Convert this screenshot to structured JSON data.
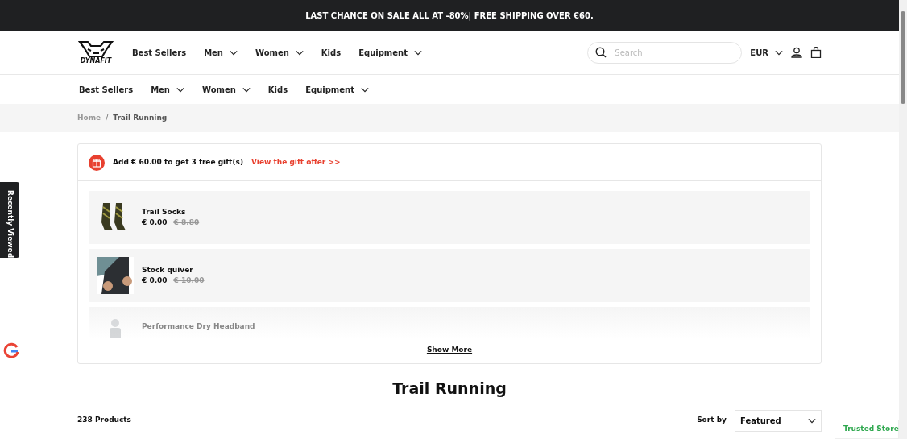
{
  "announcement": "LAST CHANCE ON SALE ALL AT -80%| FREE SHIPPING OVER €60.",
  "logo_text": "DYNAFIT",
  "header_nav": [
    {
      "label": "Best Sellers",
      "dropdown": false
    },
    {
      "label": "Men",
      "dropdown": true
    },
    {
      "label": "Women",
      "dropdown": true
    },
    {
      "label": "Kids",
      "dropdown": false
    },
    {
      "label": "Equipment",
      "dropdown": true
    }
  ],
  "search": {
    "placeholder": "Search"
  },
  "currency": "EUR",
  "sub_nav": [
    {
      "label": "Best Sellers",
      "dropdown": false
    },
    {
      "label": "Men",
      "dropdown": true
    },
    {
      "label": "Women",
      "dropdown": true
    },
    {
      "label": "Kids",
      "dropdown": false
    },
    {
      "label": "Equipment",
      "dropdown": true
    }
  ],
  "breadcrumb": {
    "separator": "/",
    "items": [
      {
        "label": "Home",
        "current": false
      },
      {
        "label": "Trail Running",
        "current": true
      }
    ]
  },
  "gift": {
    "message": "Add € 60.00 to get 3 free gift(s)",
    "link": "View the gift offer >>",
    "items": [
      {
        "name": "Trail Socks",
        "price": "€ 0.00",
        "old_price": "€ 8.80",
        "faded": false,
        "kind": "socks"
      },
      {
        "name": "Stock quiver",
        "price": "€ 0.00",
        "old_price": "€ 10.00",
        "faded": false,
        "kind": "quiver"
      },
      {
        "name": "Performance Dry Headband",
        "faded": true,
        "kind": "headband"
      }
    ],
    "show_more": "Show More"
  },
  "title": "Trail Running",
  "product_count": "238 Products",
  "sort": {
    "label": "Sort by",
    "value": "Featured"
  },
  "recently_viewed": "Recently Viewed",
  "trusted": "Trusted Store"
}
